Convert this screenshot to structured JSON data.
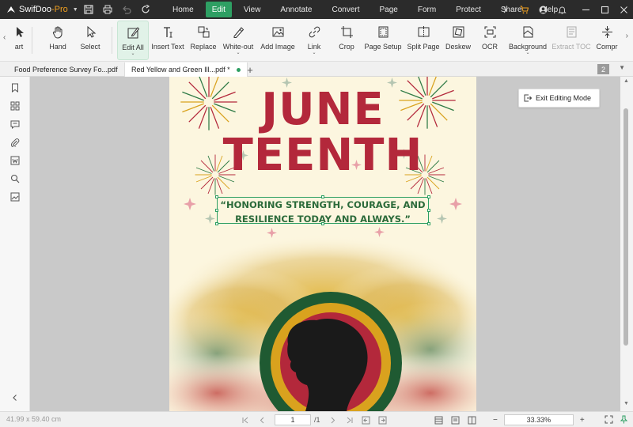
{
  "app": {
    "name": "SwifDoo",
    "edition": "-Pro"
  },
  "menu": {
    "items": [
      "Home",
      "Edit",
      "View",
      "Annotate",
      "Convert",
      "Page",
      "Form",
      "Protect",
      "Share",
      "Help"
    ],
    "active": "Edit"
  },
  "ribbon": {
    "art": "art",
    "hand": "Hand",
    "select": "Select",
    "edit_all": "Edit All",
    "insert_text": "Insert Text",
    "replace": "Replace",
    "white_out": "White-out",
    "add_image": "Add Image",
    "link": "Link",
    "crop": "Crop",
    "page_setup": "Page Setup",
    "split_page": "Split Page",
    "deskew": "Deskew",
    "ocr": "OCR",
    "background": "Background",
    "extract_toc": "Extract TOC",
    "compress": "Compr"
  },
  "tabs": {
    "items": [
      {
        "label": "Food Preference Survey Fo...pdf"
      },
      {
        "label": "Red Yellow and Green Ill...pdf *"
      }
    ],
    "add": "+",
    "count": "2"
  },
  "document": {
    "title_line1": "JUNE",
    "title_line2": "TEENTH",
    "quote_line1": "“HONORING STRENGTH, COURAGE, AND",
    "quote_line2": "RESILIENCE TODAY AND ALWAYS.”",
    "exit_editing": "Exit Editing Mode"
  },
  "status": {
    "page_size": "41.99 x 59.40 cm",
    "current_page": "1",
    "total_pages": "/1",
    "zoom": "33.33%",
    "zoom_out": "−",
    "zoom_in": "+"
  },
  "colors": {
    "accent": "#2e9f63",
    "titlebar": "#2b2b2b",
    "headline": "#b3283b",
    "quote": "#2b6a3a",
    "page_bg": "#fcf6df"
  }
}
